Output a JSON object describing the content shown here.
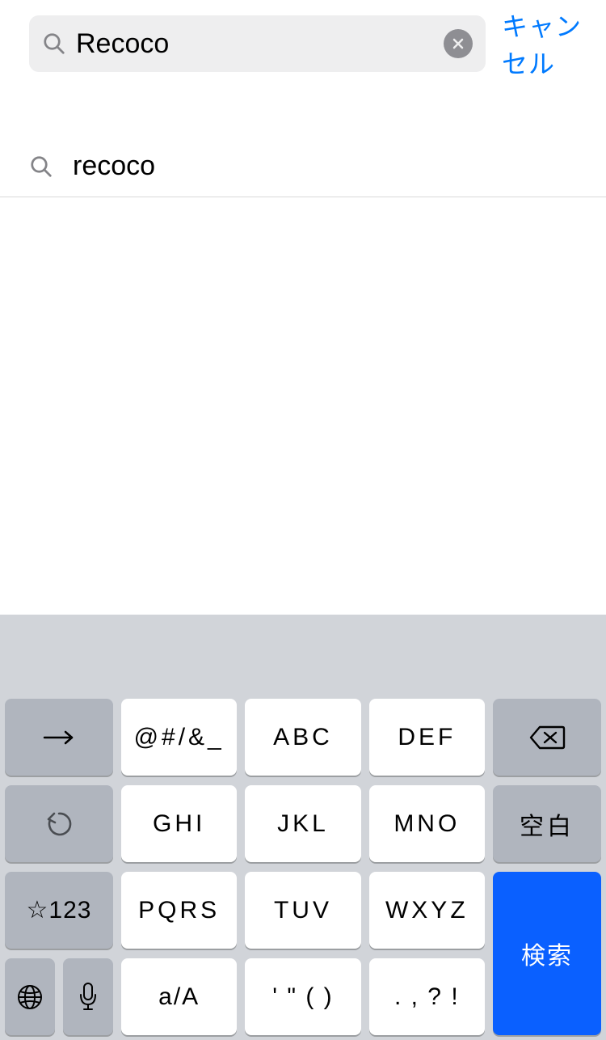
{
  "search": {
    "value": "Recoco",
    "placeholder": ""
  },
  "cancel_label": "キャンセル",
  "suggestions": [
    {
      "text": "recoco"
    }
  ],
  "keyboard": {
    "keys": {
      "symbols": "@#/&_",
      "abc": "ABC",
      "def": "DEF",
      "ghi": "GHI",
      "jkl": "JKL",
      "mno": "MNO",
      "pqrs": "PQRS",
      "tuv": "TUV",
      "wxyz": "WXYZ",
      "case": "a/A",
      "quotes": "' \" ( )",
      "punct": ". , ? !",
      "num": "☆123",
      "space": "空白",
      "search": "検索"
    }
  }
}
